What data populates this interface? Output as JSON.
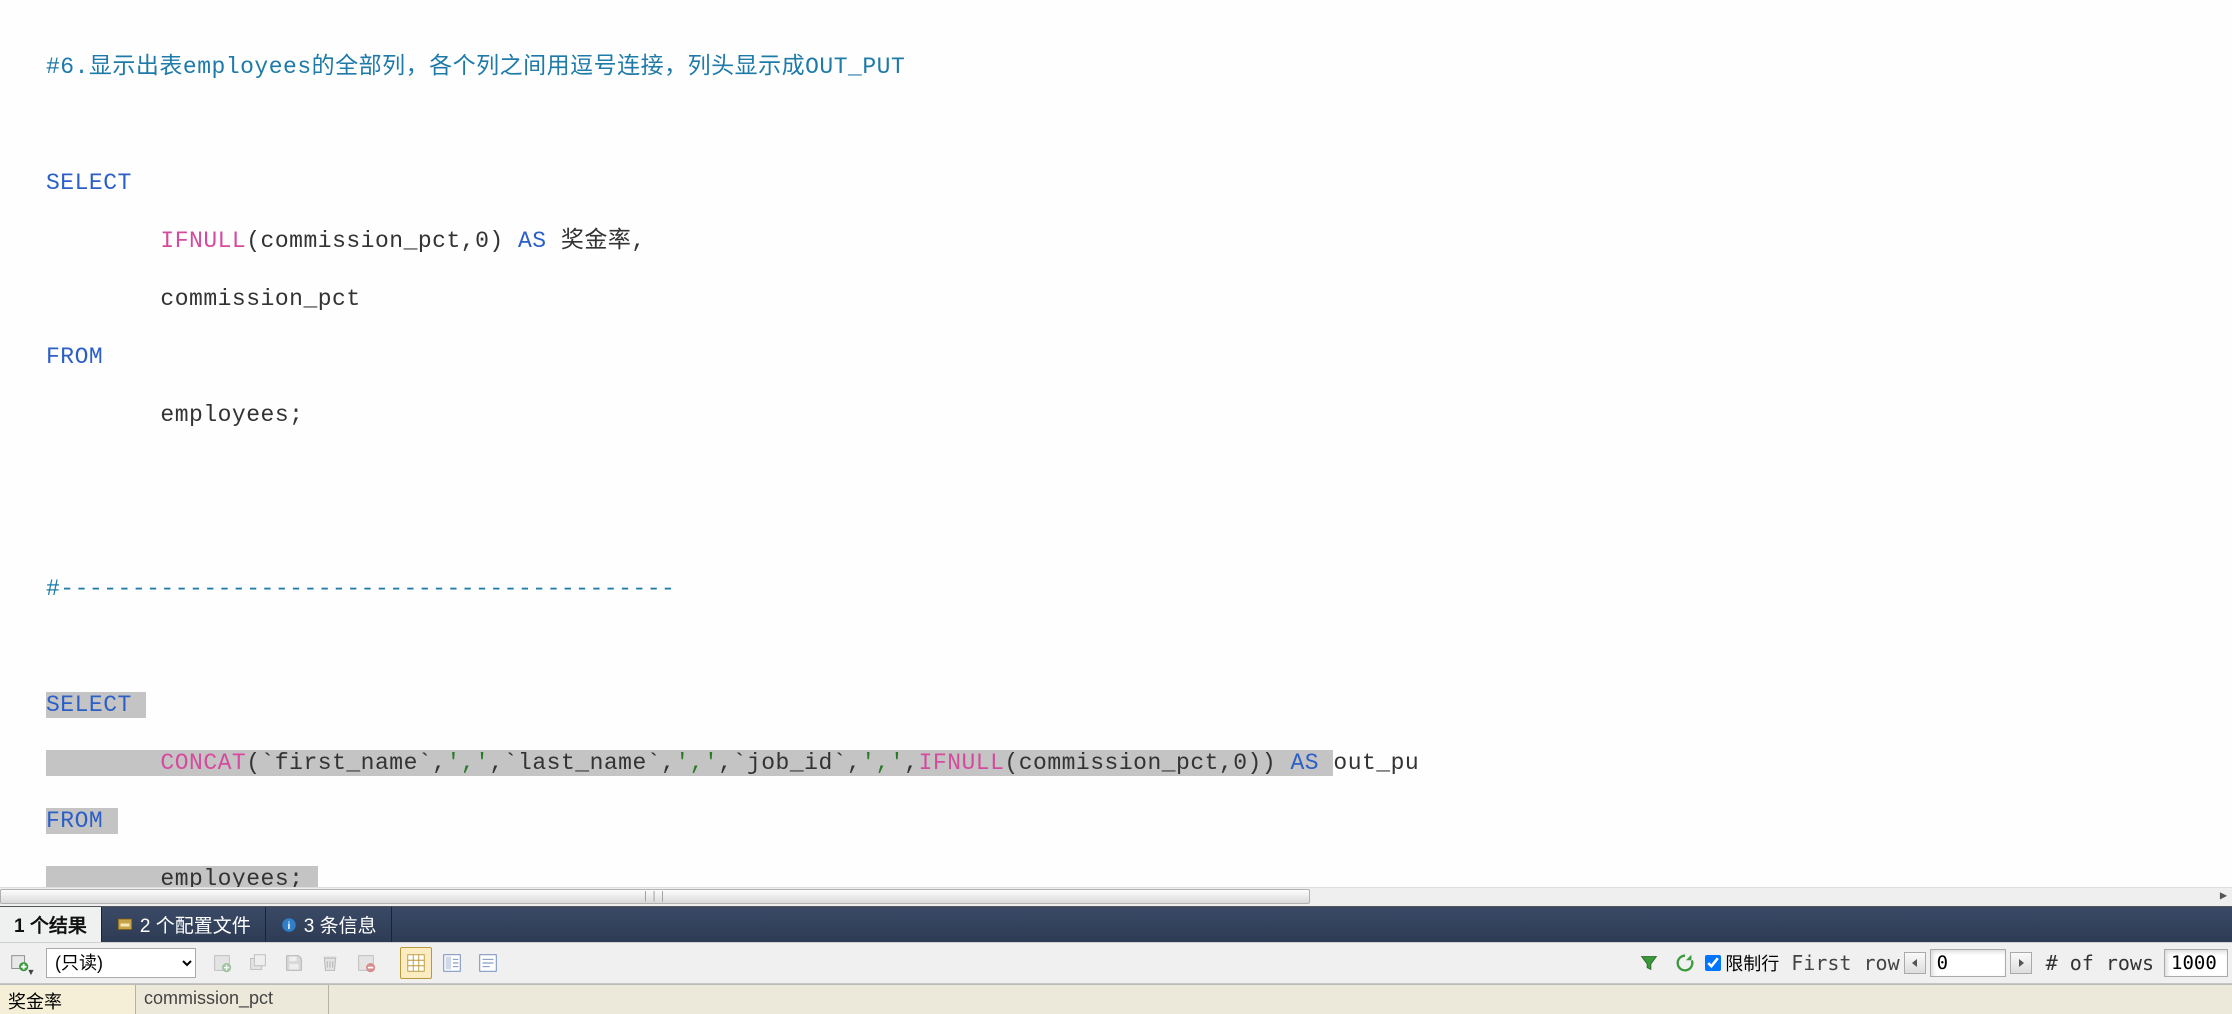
{
  "editor": {
    "l1": "#6.显示出表employees的全部列，各个列之间用逗号连接，列头显示成OUT_PUT",
    "l3_select": "SELECT",
    "l4_ifnull": "IFNULL",
    "l4_args": "(commission_pct,0)",
    "l4_as": " AS ",
    "l4_alias": "奖金率,",
    "l5_col": "commission_pct",
    "l6_from": "FROM",
    "l7_tbl": "employees;",
    "l9_sep": "#-------------------------------------------",
    "l11_select": "SELECT",
    "l12_concat": "CONCAT",
    "l12_open": "(",
    "l12_id1": "`first_name`",
    "l12_c1": ",",
    "l12_s1": "','",
    "l12_c2": ",",
    "l12_id2": "`last_name`",
    "l12_c3": ",",
    "l12_s2": "','",
    "l12_c4": ",",
    "l12_id3": "`job_id`",
    "l12_c5": ",",
    "l12_s3": "','",
    "l12_c6": ",",
    "l12_ifnull": "IFNULL",
    "l12_ifargs": "(commission_pct,0))",
    "l12_as": " AS ",
    "l12_alias": "out_pu",
    "l13_from": "FROM",
    "l14_tbl": "employees;"
  },
  "tabs": {
    "t1": "1 个结果",
    "t2": "2 个配置文件",
    "t3": "3 条信息"
  },
  "toolbar": {
    "mode": "(只读)",
    "limit_label": "限制行",
    "first_row": "First row",
    "first_row_val": "0",
    "rows_label": "# of rows",
    "rows_val": "1000"
  },
  "result_headers": {
    "c1": "奖金率",
    "c2": "commission_pct"
  }
}
